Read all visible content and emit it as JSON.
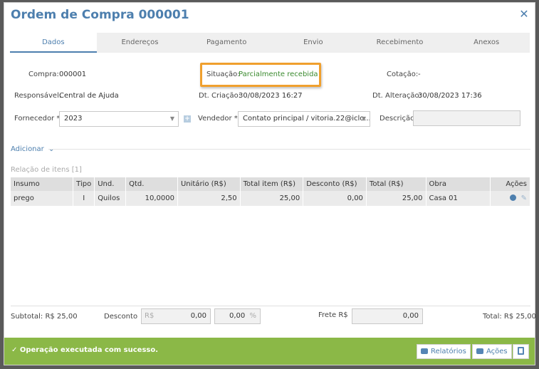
{
  "title": "Ordem de Compra 000001",
  "tabs": [
    {
      "label": "Dados"
    },
    {
      "label": "Endereços"
    },
    {
      "label": "Pagamento"
    },
    {
      "label": "Envio"
    },
    {
      "label": "Recebimento"
    },
    {
      "label": "Anexos"
    }
  ],
  "fields": {
    "compra_label": "Compra:",
    "compra_value": "000001",
    "situacao_label": "Situação:",
    "situacao_value": "Parcialmente recebida",
    "cotacao_label": "Cotação:",
    "cotacao_value": "-",
    "responsavel_label": "Responsável:",
    "responsavel_value": "Central de Ajuda",
    "dt_criacao_label": "Dt. Criação:",
    "dt_criacao_value": "30/08/2023 16:27",
    "dt_alteracao_label": "Dt. Alteração:",
    "dt_alteracao_value": "30/08/2023 17:36",
    "fornecedor_label": "Fornecedor *",
    "fornecedor_value": "2023",
    "vendedor_label": "Vendedor *",
    "vendedor_value": "Contato principal / vitoria.22@iclo...",
    "descricao_label": "Descrição",
    "descricao_value": ""
  },
  "adicionar_label": "Adicionar",
  "items_title": "Relação de itens [1]",
  "table": {
    "headers": [
      "Insumo",
      "Tipo",
      "Und.",
      "Qtd.",
      "Unitário (R$)",
      "Total item (R$)",
      "Desconto (R$)",
      "Total (R$)",
      "Obra",
      "Ações"
    ],
    "rows": [
      [
        "prego",
        "I",
        "Quilos",
        "10,0000",
        "2,50",
        "25,00",
        "0,00",
        "25,00",
        "Casa 01"
      ]
    ]
  },
  "footer": {
    "subtotal_label": "Subtotal: R$ 25,00",
    "desconto_label": "Desconto",
    "desconto_prefix": "R$",
    "desconto_value": "0,00",
    "desconto_pct_value": "0,00",
    "desconto_pct_suffix": "%",
    "frete_label": "Frete R$",
    "frete_value": "0,00",
    "total_label": "Total: R$ 25,00"
  },
  "status": {
    "message": "✓ Operação executada com sucesso.",
    "relatorios_label": "Relatórios",
    "acoes_label": "Ações"
  },
  "colors": {
    "accent": "#4d7fae",
    "success": "#8bb847",
    "highlight": "#f0a02e",
    "status_green": "#3a8a2e"
  }
}
